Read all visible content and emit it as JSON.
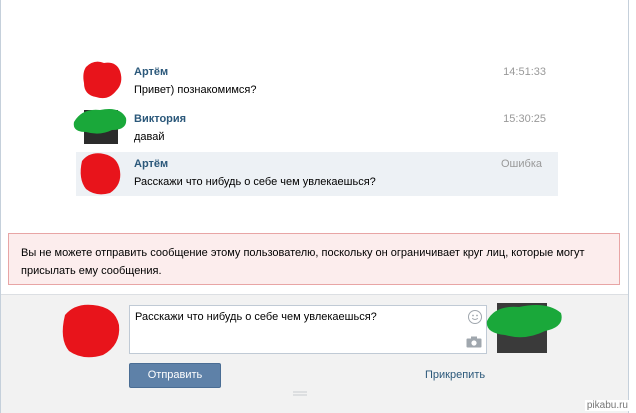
{
  "messages": [
    {
      "author": "Артём",
      "text": "Привет) познакомимся?",
      "time": "14:51:33",
      "highlighted": false
    },
    {
      "author": "Виктория",
      "text": "давай",
      "time": "15:30:25",
      "highlighted": false
    },
    {
      "author": "Артём",
      "text": "Расскажи что нибудь о себе чем увлекаешься?",
      "time": "Ошибка",
      "highlighted": true
    }
  ],
  "error_notice": "Вы не можете отправить сообщение этому пользователю, поскольку он ограничивает круг лиц, которые могут присылать ему сообщения.",
  "composer": {
    "reply_text": "Расскажи что нибудь о себе чем увлекаешься?",
    "send_label": "Отправить",
    "attach_label": "Прикрепить"
  },
  "watermark": "pikabu.ru",
  "colors": {
    "link": "#2b587a",
    "send_button": "#5e81a8",
    "error_bg": "#fceded",
    "error_border": "#e8a5a5",
    "highlight_bg": "#edf1f5",
    "scribble_red": "#e8141b",
    "scribble_green": "#1aa83a"
  },
  "icons": [
    "smile-icon",
    "camera-icon"
  ]
}
